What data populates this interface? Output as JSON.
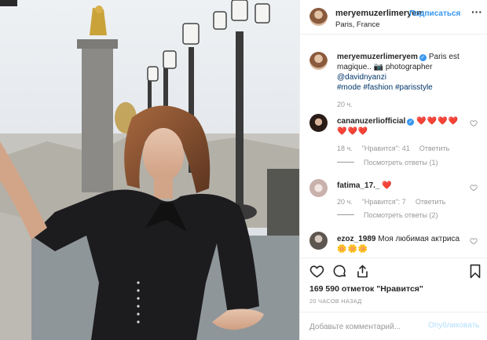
{
  "header": {
    "username": "meryemuzerlimeryem",
    "follow_label": "Подписаться",
    "location": "Paris, France",
    "more_icon": "more-horizontal-icon"
  },
  "caption": {
    "username": "meryemuzerlimeryem",
    "text": "Paris est magique.. 📷 photographer",
    "mention": "@davidnyanzi",
    "hashtags": "#mode #fashion #parisstyle",
    "time": "20 ч."
  },
  "comments": [
    {
      "username": "cananuzerliofficial",
      "verified": true,
      "text": "❤️❤️❤️❤️",
      "text2": "❤️❤️❤️",
      "time": "18 ч.",
      "likes": "\"Нравится\": 41",
      "reply": "Ответить",
      "view_replies": "Посмотреть ответы (1)"
    },
    {
      "username": "fatima_17._",
      "verified": false,
      "text": "❤️",
      "time": "20 ч.",
      "likes": "\"Нравится\": 7",
      "reply": "Ответить",
      "view_replies": "Посмотреть ответы (2)"
    },
    {
      "username": "ezoz_1989",
      "verified": false,
      "text": "Моя любимая актриса",
      "text2": "🌼🌼🌼"
    }
  ],
  "actions": {
    "likes": "169 590 отметок \"Нравится\"",
    "timestamp": "20 ЧАСОВ НАЗАД",
    "icons": [
      "heart-icon",
      "comment-icon",
      "share-icon",
      "bookmark-icon"
    ]
  },
  "add_comment": {
    "placeholder": "Добавьте комментарий...",
    "publish_label": "Опубликовать"
  },
  "colors": {
    "link": "#3897f0",
    "hashtag": "#003569",
    "muted": "#999999",
    "heart": "#ed1c24"
  }
}
